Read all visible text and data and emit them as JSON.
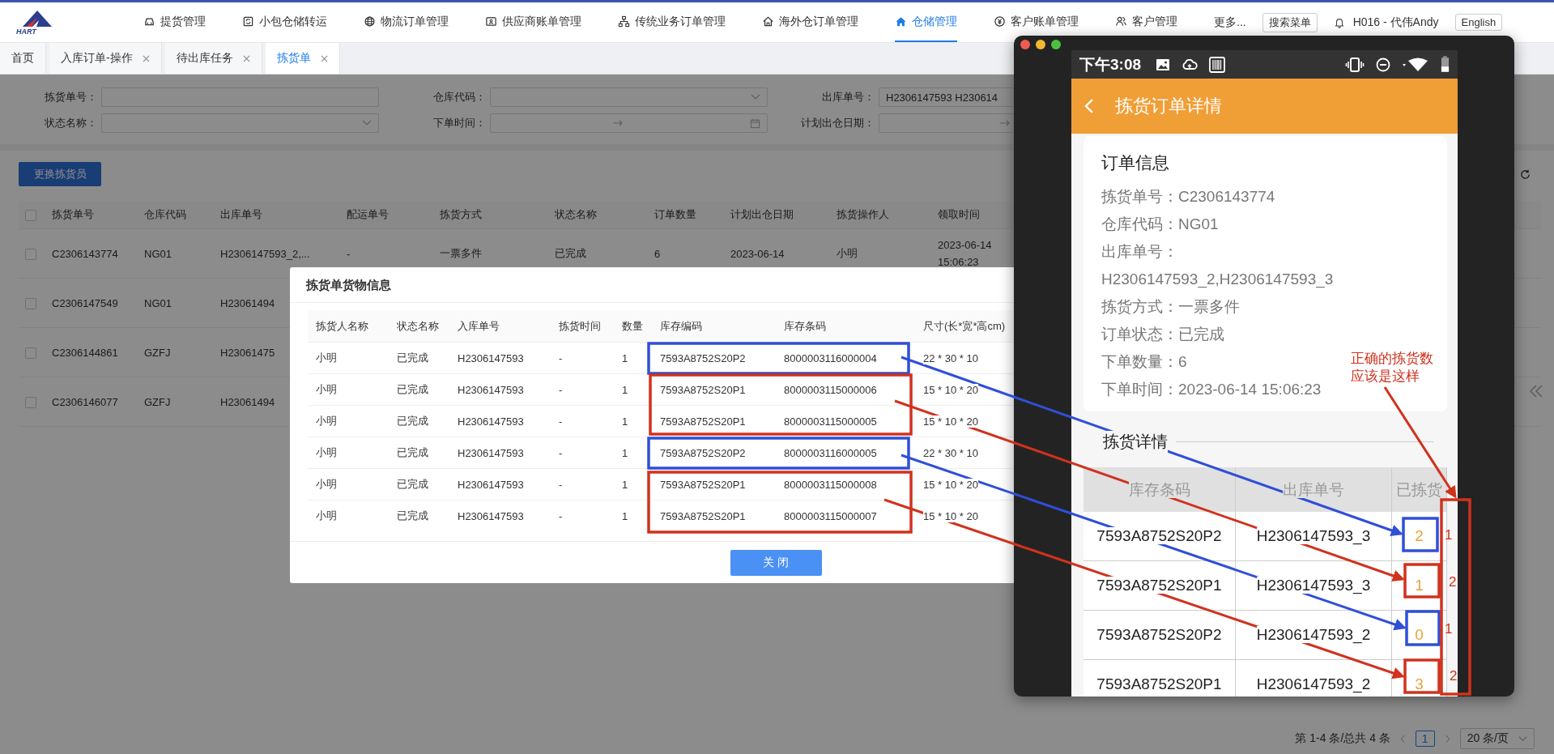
{
  "logo": {
    "text": "HART"
  },
  "header": {
    "nav": [
      {
        "label": "提货管理",
        "selected": false
      },
      {
        "label": "小包仓储转运",
        "selected": false
      },
      {
        "label": "物流订单管理",
        "selected": false
      },
      {
        "label": "供应商账单管理",
        "selected": false
      },
      {
        "label": "传统业务订单管理",
        "selected": false
      },
      {
        "label": "海外仓订单管理",
        "selected": false
      },
      {
        "label": "仓储管理",
        "selected": true
      },
      {
        "label": "客户账单管理",
        "selected": false
      },
      {
        "label": "客户管理",
        "selected": false
      }
    ],
    "more": "更多...",
    "search_button": "搜索菜单",
    "user": "H016 - 代伟Andy",
    "language": "English"
  },
  "tabs": [
    {
      "label": "首页",
      "selected": false,
      "closable": false
    },
    {
      "label": "入库订单-操作",
      "selected": false,
      "closable": true
    },
    {
      "label": "待出库任务",
      "selected": false,
      "closable": true
    },
    {
      "label": "拣货单",
      "selected": true,
      "closable": true
    }
  ],
  "filters": [
    {
      "label": "拣货单号：",
      "kind": "text"
    },
    {
      "label": "仓库代码：",
      "kind": "select"
    },
    {
      "label": "出库单号：",
      "kind": "text",
      "value": "H2306147593 H230614"
    },
    {
      "label": "状态名称：",
      "kind": "select"
    },
    {
      "label": "下单时间：",
      "kind": "date_range"
    },
    {
      "label": "计划出仓日期：",
      "kind": "date_range"
    }
  ],
  "toolbar": {
    "button": "更换拣货员"
  },
  "table": {
    "columns": [
      "拣货单号",
      "仓库代码",
      "出库单号",
      "配运单号",
      "拣货方式",
      "状态名称",
      "订单数量",
      "计划出仓日期",
      "拣货操作人",
      "领取时间"
    ],
    "header_checked": false,
    "rows": [
      {
        "checked": false,
        "cells": [
          "C2306143774",
          "NG01",
          "H2306147593_2,...",
          "-",
          "一票多件",
          "已完成",
          "6",
          "2023-06-14",
          "小明",
          "2023-06-14 15:06:23"
        ]
      },
      {
        "checked": false,
        "cells": [
          "C2306147549",
          "NG01",
          "H23061494"
        ]
      },
      {
        "checked": false,
        "cells": [
          "C2306144861",
          "GZFJ",
          "H23061475"
        ]
      },
      {
        "checked": false,
        "cells": [
          "C2306146077",
          "GZFJ",
          "H23061494"
        ]
      }
    ]
  },
  "pagination": {
    "summary": "第 1-4 条/总共 4 条",
    "pages": [
      {
        "label": "1",
        "selected": true
      }
    ],
    "page_size": "20 条/页"
  },
  "modal": {
    "title": "拣货单货物信息",
    "columns": [
      "拣货人名称",
      "状态名称",
      "入库单号",
      "拣货时间",
      "数量",
      "库存编码",
      "库存条码",
      "尺寸(长*宽*高cm)"
    ],
    "rows": [
      [
        "小明",
        "已完成",
        "H2306147593",
        "-",
        "1",
        "7593A8752S20P2",
        "8000003116000004",
        "22 * 30 * 10"
      ],
      [
        "小明",
        "已完成",
        "H2306147593",
        "-",
        "1",
        "7593A8752S20P1",
        "8000003115000006",
        "15 * 10 * 20"
      ],
      [
        "小明",
        "已完成",
        "H2306147593",
        "-",
        "1",
        "7593A8752S20P1",
        "8000003115000005",
        "15 * 10 * 20"
      ],
      [
        "小明",
        "已完成",
        "H2306147593",
        "-",
        "1",
        "7593A8752S20P2",
        "8000003116000005",
        "22 * 30 * 10"
      ],
      [
        "小明",
        "已完成",
        "H2306147593",
        "-",
        "1",
        "7593A8752S20P1",
        "8000003115000008",
        "15 * 10 * 20"
      ],
      [
        "小明",
        "已完成",
        "H2306147593",
        "-",
        "1",
        "7593A8752S20P1",
        "8000003115000007",
        "15 * 10 * 20"
      ]
    ],
    "close_button": "关 闭"
  },
  "phone": {
    "time": "下午3:08",
    "title": "拣货订单详情",
    "info_title": "订单信息",
    "fields": [
      {
        "label": "拣货单号：",
        "value": "C2306143774"
      },
      {
        "label": "仓库代码：",
        "value": "NG01"
      },
      {
        "label": "出库单号：",
        "value": "H2306147593_2,H2306147593_3"
      },
      {
        "label": "拣货方式：",
        "value": "一票多件"
      },
      {
        "label": "订单状态：",
        "value": "已完成"
      },
      {
        "label": "下单数量：",
        "value": "6"
      },
      {
        "label": "下单时间：",
        "value": "2023-06-14 15:06:23"
      }
    ],
    "detail_title": "拣货详情",
    "columns": [
      "库存条码",
      "出库单号",
      "已拣货"
    ],
    "rows": [
      {
        "barcode": "7593A8752S20P2",
        "order": "H2306147593_3",
        "picked": "2"
      },
      {
        "barcode": "7593A8752S20P1",
        "order": "H2306147593_3",
        "picked": "1"
      },
      {
        "barcode": "7593A8752S20P2",
        "order": "H2306147593_2",
        "picked": "0"
      },
      {
        "barcode": "7593A8752S20P1",
        "order": "H2306147593_2",
        "picked": "3"
      }
    ]
  },
  "annotations": {
    "boxes": [
      {
        "color": "#2f4fd8"
      },
      {
        "color": "#d0321e"
      },
      {
        "color": "#2f4fd8"
      },
      {
        "color": "#d0321e"
      },
      {
        "color": "#2f4fd8"
      },
      {
        "color": "#d0321e"
      },
      {
        "color": "#2f4fd8"
      },
      {
        "color": "#d0321e"
      },
      {
        "color": "#d0321e"
      }
    ],
    "arrows": [
      {
        "color": "#2f4fd8"
      },
      {
        "color": "#d0321e"
      },
      {
        "color": "#2f4fd8"
      },
      {
        "color": "#d0321e"
      },
      {
        "color": "#d0321e"
      }
    ],
    "note": [
      "正确的拣货数",
      "应该是这样"
    ],
    "counts": [
      "1",
      "2",
      "1",
      "2"
    ]
  }
}
